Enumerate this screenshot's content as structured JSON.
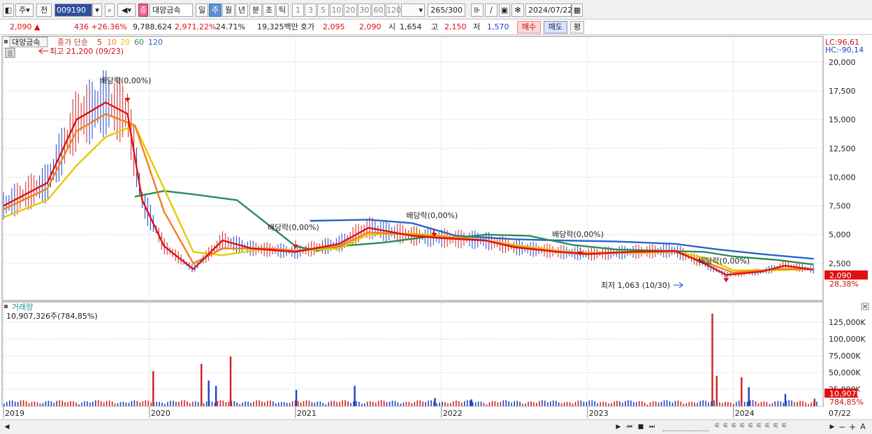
{
  "toolbar": {
    "menu_label": "주",
    "prev_label": "전",
    "code": "009190",
    "name_badge": "종",
    "name": "대양금속",
    "periods": [
      {
        "label": "일",
        "selected": false
      },
      {
        "label": "주",
        "selected": true
      },
      {
        "label": "월",
        "selected": false
      },
      {
        "label": "년",
        "selected": false
      },
      {
        "label": "분",
        "selected": false
      },
      {
        "label": "초",
        "selected": false
      },
      {
        "label": "틱",
        "selected": false
      }
    ],
    "ticks": [
      "1",
      "3",
      "5",
      "10",
      "20",
      "30",
      "60",
      "120"
    ],
    "count": "265",
    "count_total": "/300",
    "date": "2024/07/22"
  },
  "quote": {
    "price": "2,090 ▲",
    "change": "436 +26.36%",
    "volume": "9,788,624",
    "volume_ratio": "2,971.22%",
    "turnover": "24.71%",
    "amount": "19,325백만",
    "ask_label": "호가",
    "ask": "2,095",
    "bid": "2,090",
    "open_label": "시",
    "open": "1,654",
    "high_label": "고",
    "high": "2,150",
    "low_label": "저",
    "low": "1,570",
    "buy_label": "매수",
    "sell_label": "매도",
    "avg_label": "평"
  },
  "chart": {
    "stock_label": "대양금속",
    "legend_prefix": "종가 단순",
    "legend_periods": [
      {
        "label": "5",
        "color": "#e01010"
      },
      {
        "label": "10",
        "color": "#f08020"
      },
      {
        "label": "20",
        "color": "#e6c800"
      },
      {
        "label": "60",
        "color": "#2e8b57"
      },
      {
        "label": "120",
        "color": "#2a64c8"
      }
    ],
    "high_note": "최고 21,200 (09/23)",
    "low_note": "최저 1,063 (10/30)",
    "dividend_label": "배당락(0,00%)",
    "lc": "LC:96,61",
    "hc": "HC:-90,14",
    "current_price_tag": "2,090",
    "current_pct_tag": "28,38%",
    "y_labels": [
      "20,000",
      "17,500",
      "15,000",
      "12,500",
      "10,000",
      "7,500",
      "5,000",
      "2,500"
    ],
    "x_labels": [
      "2019",
      "2020",
      "2021",
      "2022",
      "2023",
      "2024",
      "07/22"
    ],
    "volume_title": "거래량",
    "volume_value": "10,907,326주(784,85%)",
    "volume_y_labels": [
      "125,000K",
      "100,000K",
      "75,000K",
      "50,000K",
      "25,000K"
    ],
    "volume_tag": "10,907K",
    "volume_pct_tag": "784,85%"
  },
  "chart_data": {
    "type": "line",
    "title": "대양금속",
    "x_labels": [
      "2019",
      "2020",
      "2021",
      "2022",
      "2023",
      "2024",
      "07/22"
    ],
    "ylim": [
      0,
      22000
    ],
    "series": [
      {
        "name": "5",
        "color": "#e01010",
        "points": [
          [
            2019.0,
            7500
          ],
          [
            2019.3,
            9500
          ],
          [
            2019.5,
            15000
          ],
          [
            2019.7,
            16500
          ],
          [
            2019.85,
            15500
          ],
          [
            2019.95,
            8000
          ],
          [
            2020.1,
            4000
          ],
          [
            2020.3,
            2000
          ],
          [
            2020.5,
            4500
          ],
          [
            2020.7,
            3800
          ],
          [
            2021.0,
            3500
          ],
          [
            2021.3,
            4200
          ],
          [
            2021.5,
            5600
          ],
          [
            2021.8,
            4900
          ],
          [
            2022.0,
            4700
          ],
          [
            2022.3,
            4500
          ],
          [
            2022.5,
            3900
          ],
          [
            2022.8,
            3500
          ],
          [
            2023.0,
            3300
          ],
          [
            2023.3,
            3500
          ],
          [
            2023.6,
            3600
          ],
          [
            2023.8,
            2500
          ],
          [
            2023.95,
            1500
          ],
          [
            2024.2,
            1800
          ],
          [
            2024.35,
            2300
          ],
          [
            2024.55,
            1950
          ]
        ]
      },
      {
        "name": "10",
        "color": "#f08020",
        "points": [
          [
            2019.0,
            7200
          ],
          [
            2019.3,
            9000
          ],
          [
            2019.5,
            14000
          ],
          [
            2019.7,
            15500
          ],
          [
            2019.9,
            14500
          ],
          [
            2020.1,
            7000
          ],
          [
            2020.3,
            2500
          ],
          [
            2020.5,
            3800
          ],
          [
            2020.8,
            3800
          ],
          [
            2021.0,
            3600
          ],
          [
            2021.3,
            4000
          ],
          [
            2021.5,
            5200
          ],
          [
            2021.8,
            5000
          ],
          [
            2022.0,
            4800
          ],
          [
            2022.3,
            4500
          ],
          [
            2022.5,
            4000
          ],
          [
            2022.8,
            3500
          ],
          [
            2023.0,
            3400
          ],
          [
            2023.3,
            3500
          ],
          [
            2023.6,
            3500
          ],
          [
            2023.85,
            2400
          ],
          [
            2024.0,
            1700
          ],
          [
            2024.3,
            2000
          ],
          [
            2024.55,
            2000
          ]
        ]
      },
      {
        "name": "20",
        "color": "#e6c800",
        "points": [
          [
            2019.0,
            6500
          ],
          [
            2019.3,
            8000
          ],
          [
            2019.5,
            11000
          ],
          [
            2019.7,
            13500
          ],
          [
            2019.9,
            14500
          ],
          [
            2020.1,
            9000
          ],
          [
            2020.3,
            3500
          ],
          [
            2020.5,
            3200
          ],
          [
            2020.8,
            3800
          ],
          [
            2021.0,
            3600
          ],
          [
            2021.3,
            3800
          ],
          [
            2021.5,
            5000
          ],
          [
            2021.8,
            5100
          ],
          [
            2022.0,
            4900
          ],
          [
            2022.3,
            4500
          ],
          [
            2022.5,
            4100
          ],
          [
            2022.8,
            3600
          ],
          [
            2023.0,
            3400
          ],
          [
            2023.3,
            3400
          ],
          [
            2023.6,
            3500
          ],
          [
            2023.8,
            3000
          ],
          [
            2024.0,
            1900
          ],
          [
            2024.3,
            1900
          ],
          [
            2024.55,
            2000
          ]
        ]
      },
      {
        "name": "60",
        "color": "#2e8b57",
        "points": [
          [
            2019.9,
            8300
          ],
          [
            2020.1,
            8800
          ],
          [
            2020.3,
            8500
          ],
          [
            2020.6,
            8000
          ],
          [
            2020.8,
            6000
          ],
          [
            2021.0,
            4000
          ],
          [
            2021.15,
            3600
          ],
          [
            2021.3,
            4000
          ],
          [
            2021.6,
            4300
          ],
          [
            2021.9,
            4800
          ],
          [
            2022.1,
            4700
          ],
          [
            2022.3,
            5000
          ],
          [
            2022.6,
            4900
          ],
          [
            2022.9,
            4100
          ],
          [
            2023.2,
            3700
          ],
          [
            2023.5,
            3600
          ],
          [
            2023.8,
            3500
          ],
          [
            2024.0,
            3100
          ],
          [
            2024.3,
            2800
          ],
          [
            2024.55,
            2400
          ]
        ]
      },
      {
        "name": "120",
        "color": "#2a64c8",
        "points": [
          [
            2021.1,
            6200
          ],
          [
            2021.5,
            6300
          ],
          [
            2021.8,
            6000
          ],
          [
            2022.1,
            4900
          ],
          [
            2022.5,
            4600
          ],
          [
            2022.8,
            4500
          ],
          [
            2023.2,
            4400
          ],
          [
            2023.6,
            4200
          ],
          [
            2023.9,
            3700
          ],
          [
            2024.2,
            3300
          ],
          [
            2024.55,
            2900
          ]
        ]
      }
    ],
    "dividend_markers": [
      2019.85,
      2021.0,
      2021.95,
      2022.95,
      2023.95
    ],
    "volume": {
      "unit": "K shares",
      "bars": [
        [
          2020.02,
          52000
        ],
        [
          2020.35,
          63000
        ],
        [
          2020.4,
          38000
        ],
        [
          2020.45,
          30000
        ],
        [
          2020.55,
          74000
        ],
        [
          2021.0,
          24000
        ],
        [
          2021.4,
          30000
        ],
        [
          2021.95,
          12000
        ],
        [
          2022.2,
          10000
        ],
        [
          2023.85,
          138000
        ],
        [
          2023.88,
          45000
        ],
        [
          2024.05,
          43000
        ],
        [
          2024.1,
          28000
        ],
        [
          2024.35,
          18000
        ],
        [
          2024.55,
          10907
        ]
      ]
    }
  },
  "bottombar": {
    "nav_icons": [
      "play-icon",
      "rewind-icon",
      "stop-icon",
      "forward-icon"
    ],
    "zoom": [
      "−",
      "+",
      "A"
    ]
  }
}
